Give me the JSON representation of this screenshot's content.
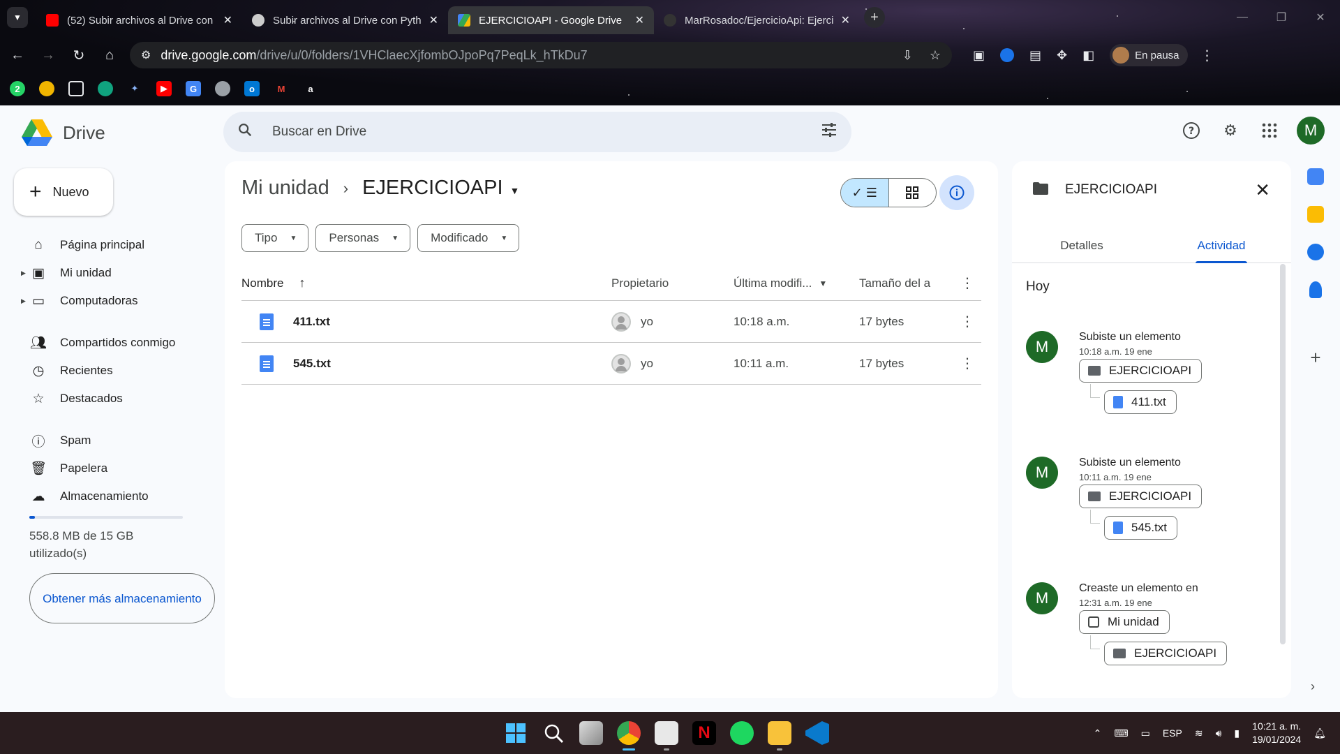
{
  "browser": {
    "tabs": [
      {
        "title": "(52) Subir archivos al Drive con",
        "favicon_color": "#ff0000",
        "active": false
      },
      {
        "title": "Subir archivos al Drive con Pyth",
        "favicon_color": "#cccccc",
        "active": false
      },
      {
        "title": "EJERCICIOAPI - Google Drive",
        "favicon_color": "#34a853",
        "active": true
      },
      {
        "title": "MarRosadoc/EjercicioApi: Ejerci",
        "favicon_color": "#333333",
        "active": false
      }
    ],
    "url_host": "drive.google.com",
    "url_path": "/drive/u/0/folders/1VHClaecXjfombOJpoPq7PeqLk_hTkDu7",
    "profile_status": "En pausa",
    "bookmark_icons": [
      "whatsapp-icon",
      "linktree-icon",
      "folder-icon",
      "chatgpt-icon",
      "gemini-icon",
      "youtube-icon",
      "translate-icon",
      "globe-icon",
      "outlook-icon",
      "gmail-icon",
      "amazon-icon"
    ]
  },
  "drive": {
    "app_name": "Drive",
    "search_placeholder": "Buscar en Drive",
    "user_initial": "M",
    "new_button": "Nuevo",
    "nav": [
      {
        "label": "Página principal",
        "icon": "home-icon"
      },
      {
        "label": "Mi unidad",
        "icon": "drive-icon"
      },
      {
        "label": "Computadoras",
        "icon": "computer-icon"
      },
      {
        "label": "Compartidos conmigo",
        "icon": "people-icon"
      },
      {
        "label": "Recientes",
        "icon": "clock-icon"
      },
      {
        "label": "Destacados",
        "icon": "star-icon"
      },
      {
        "label": "Spam",
        "icon": "spam-icon"
      },
      {
        "label": "Papelera",
        "icon": "trash-icon"
      },
      {
        "label": "Almacenamiento",
        "icon": "cloud-icon"
      }
    ],
    "storage": {
      "used_text": "558.8 MB de 15 GB utilizado(s)",
      "used_fraction": 0.037,
      "cta": "Obtener más almacenamiento"
    },
    "breadcrumb": {
      "root": "Mi unidad",
      "current": "EJERCICIOAPI"
    },
    "filters": [
      "Tipo",
      "Personas",
      "Modificado"
    ],
    "columns": {
      "name": "Nombre",
      "owner": "Propietario",
      "modified": "Última modifi...",
      "size": "Tamaño del a"
    },
    "files": [
      {
        "name": "411.txt",
        "owner": "yo",
        "modified": "10:18 a.m.",
        "size": "17 bytes"
      },
      {
        "name": "545.txt",
        "owner": "yo",
        "modified": "10:11 a.m.",
        "size": "17 bytes"
      }
    ],
    "details": {
      "title": "EJERCICIOAPI",
      "tabs": [
        "Detalles",
        "Actividad"
      ],
      "active_tab": "Actividad",
      "section": "Hoy",
      "activities": [
        {
          "title": "Subiste un elemento",
          "time": "10:18 a.m. 19 ene",
          "parent": "EJERCICIOAPI",
          "child": "411.txt"
        },
        {
          "title": "Subiste un elemento",
          "time": "10:11 a.m. 19 ene",
          "parent": "EJERCICIOAPI",
          "child": "545.txt"
        },
        {
          "title": "Creaste un elemento en",
          "time": "12:31 a.m. 19 ene",
          "parent": "Mi unidad",
          "child": "EJERCICIOAPI"
        }
      ]
    }
  },
  "taskbar": {
    "language": "ESP",
    "time": "10:21 a. m.",
    "date": "19/01/2024"
  },
  "colors": {
    "accent": "#0b57d0",
    "avatar_green": "#1e6a27",
    "selected_bg": "#c2e7ff"
  }
}
